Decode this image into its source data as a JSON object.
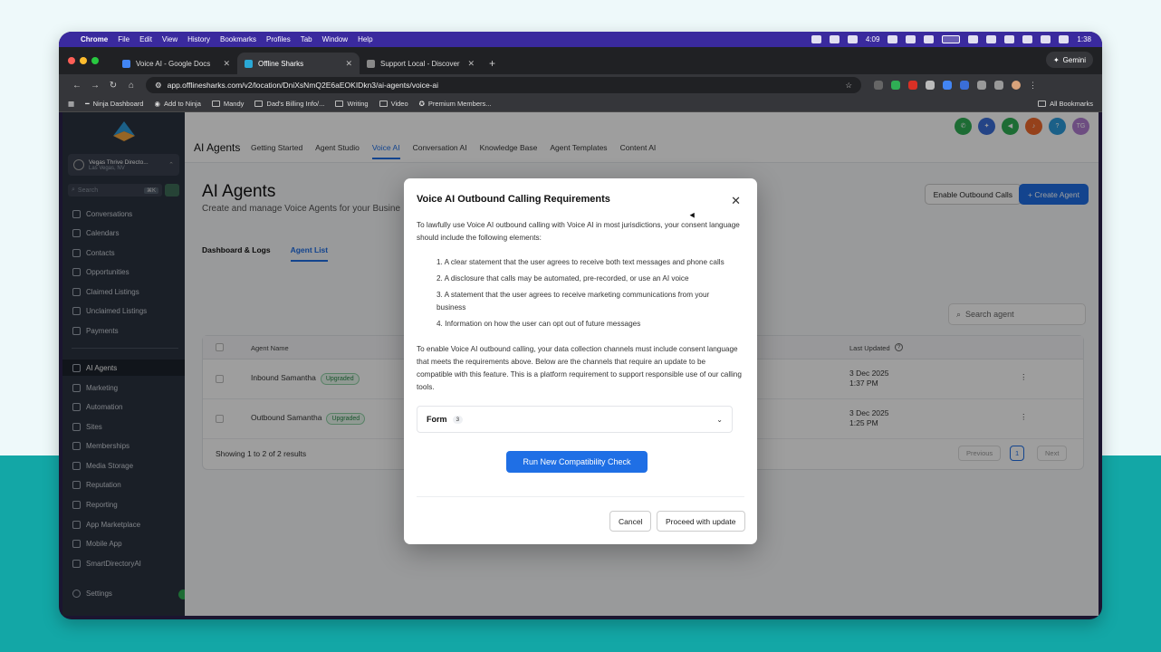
{
  "menubar": {
    "items": [
      "Chrome",
      "File",
      "Edit",
      "View",
      "History",
      "Bookmarks",
      "Profiles",
      "Tab",
      "Window",
      "Help"
    ],
    "time_small": "4:09",
    "clock": "1:38"
  },
  "browser": {
    "tabs": [
      {
        "title": "Voice AI - Google Docs",
        "color": "#4285f4"
      },
      {
        "title": "Offline Sharks",
        "color": "#2aa8d6"
      },
      {
        "title": "Support Local - Discover & S",
        "color": "#888888"
      }
    ],
    "gemini": "Gemini",
    "url": "app.offlinesharks.com/v2/location/DniXsNmQ2E6aEOKIDkn3/ai-agents/voice-ai",
    "bookmarks": [
      "Ninja Dashboard",
      "Add to Ninja",
      "Mandy",
      "Dad's Billing Info/...",
      "Writing",
      "Video",
      "Premium Members..."
    ],
    "all_bookmarks": "All Bookmarks"
  },
  "sidebar": {
    "location_name": "Vegas Thrive Directo...",
    "location_sub": "Las Vegas, NV",
    "search_placeholder": "Search",
    "search_kbd": "⌘K",
    "items": [
      "Conversations",
      "Calendars",
      "Contacts",
      "Opportunities",
      "Claimed Listings",
      "Unclaimed Listings",
      "Payments"
    ],
    "items2": [
      "AI Agents",
      "Marketing",
      "Automation",
      "Sites",
      "Memberships",
      "Media Storage",
      "Reputation",
      "Reporting",
      "App Marketplace",
      "Mobile App",
      "SmartDirectoryAI"
    ],
    "settings": "Settings"
  },
  "topnav": {
    "title": "AI Agents",
    "links": [
      "Getting Started",
      "Agent Studio",
      "Voice AI",
      "Conversation AI",
      "Knowledge Base",
      "Agent Templates",
      "Content AI"
    ],
    "avatar_initials": "TG",
    "help": "?"
  },
  "page": {
    "title": "AI Agents",
    "subtitle": "Create and manage Voice Agents for your Busine",
    "enable_button": "Enable Outbound Calls",
    "create_button": "+ Create Agent",
    "subtabs": [
      "Dashboard & Logs",
      "Agent List"
    ],
    "search_placeholder": "Search agent"
  },
  "table": {
    "headers": {
      "name": "Agent Name",
      "updated": "Last Updated"
    },
    "rows": [
      {
        "name": "Inbound Samantha",
        "badge": "Upgraded",
        "date": "3 Dec 2025",
        "time": "1:37 PM"
      },
      {
        "name": "Outbound Samantha",
        "badge": "Upgraded",
        "date": "3 Dec 2025",
        "time": "1:25 PM"
      }
    ],
    "showing": "Showing 1 to 2 of 2 results",
    "previous": "Previous",
    "page": "1",
    "next": "Next"
  },
  "modal": {
    "title": "Voice AI Outbound Calling Requirements",
    "intro": "To lawfully use Voice AI outbound calling with Voice AI in most jurisdictions, your consent language should include the following elements:",
    "requirements": [
      "1. A clear statement that the user agrees to receive both text messages and phone calls",
      "2. A disclosure that calls may be automated, pre-recorded, or use an AI voice",
      "3. A statement that the user agrees to receive marketing communications from your business",
      "4. Information on how the user can opt out of future messages"
    ],
    "body": "To enable Voice AI outbound calling, your data collection channels must include consent language that meets the requirements above. Below are the channels that require an update to be compatible with this feature. This is a platform requirement to support responsible use of our calling tools.",
    "accordion_label": "Form",
    "accordion_count": "3",
    "run_button": "Run New Compatibility Check",
    "cancel_button": "Cancel",
    "proceed_button": "Proceed with update"
  }
}
